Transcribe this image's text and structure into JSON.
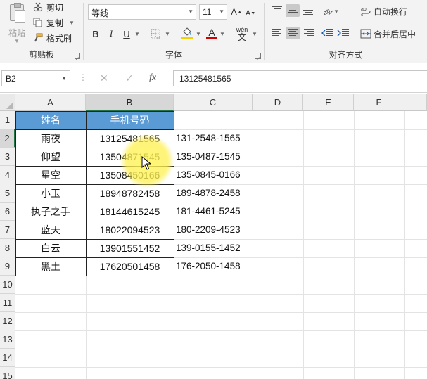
{
  "ribbon": {
    "clipboard": {
      "paste_label": "粘贴",
      "cut_label": "剪切",
      "copy_label": "复制",
      "format_painter_label": "格式刷",
      "group_label": "剪贴板"
    },
    "font": {
      "font_name": "等线",
      "font_size": "11",
      "bold": "B",
      "italic": "I",
      "underline": "U",
      "phonetic_label": "wén",
      "phonetic_char": "文",
      "increase_font": "A",
      "decrease_font": "A",
      "font_color_label": "A",
      "group_label": "字体",
      "fill_color": "#f2d200",
      "font_color": "#d00000"
    },
    "alignment": {
      "wrap_text_label": "自动换行",
      "merge_center_label": "合并后居中",
      "group_label": "对齐方式"
    }
  },
  "formula_bar": {
    "name_box": "B2",
    "cancel_icon": "✕",
    "enter_icon": "✓",
    "fx_label": "fx",
    "formula": "13125481565"
  },
  "sheet": {
    "columns": [
      "A",
      "B",
      "C",
      "D",
      "E",
      "F"
    ],
    "rows": [
      "1",
      "2",
      "3",
      "4",
      "5",
      "6",
      "7",
      "8",
      "9",
      "10",
      "11",
      "12",
      "13",
      "14",
      "15"
    ],
    "selected_cell": "B2",
    "header": {
      "name": "姓名",
      "phone": "手机号码"
    },
    "data": [
      {
        "name": "雨夜",
        "phone": "13125481565",
        "formatted": "131-2548-1565"
      },
      {
        "name": "仰望",
        "phone": "13504871545",
        "formatted": "135-0487-1545"
      },
      {
        "name": "星空",
        "phone": "13508450166",
        "formatted": "135-0845-0166"
      },
      {
        "name": "小玉",
        "phone": "18948782458",
        "formatted": "189-4878-2458"
      },
      {
        "name": "执子之手",
        "phone": "18144615245",
        "formatted": "181-4461-5245"
      },
      {
        "name": "蓝天",
        "phone": "18022094523",
        "formatted": "180-2209-4523"
      },
      {
        "name": "白云",
        "phone": "13901551452",
        "formatted": "139-0155-1452"
      },
      {
        "name": "黑土",
        "phone": "17620501458",
        "formatted": "176-2050-1458"
      }
    ],
    "header_fill": "#5b9bd5"
  }
}
